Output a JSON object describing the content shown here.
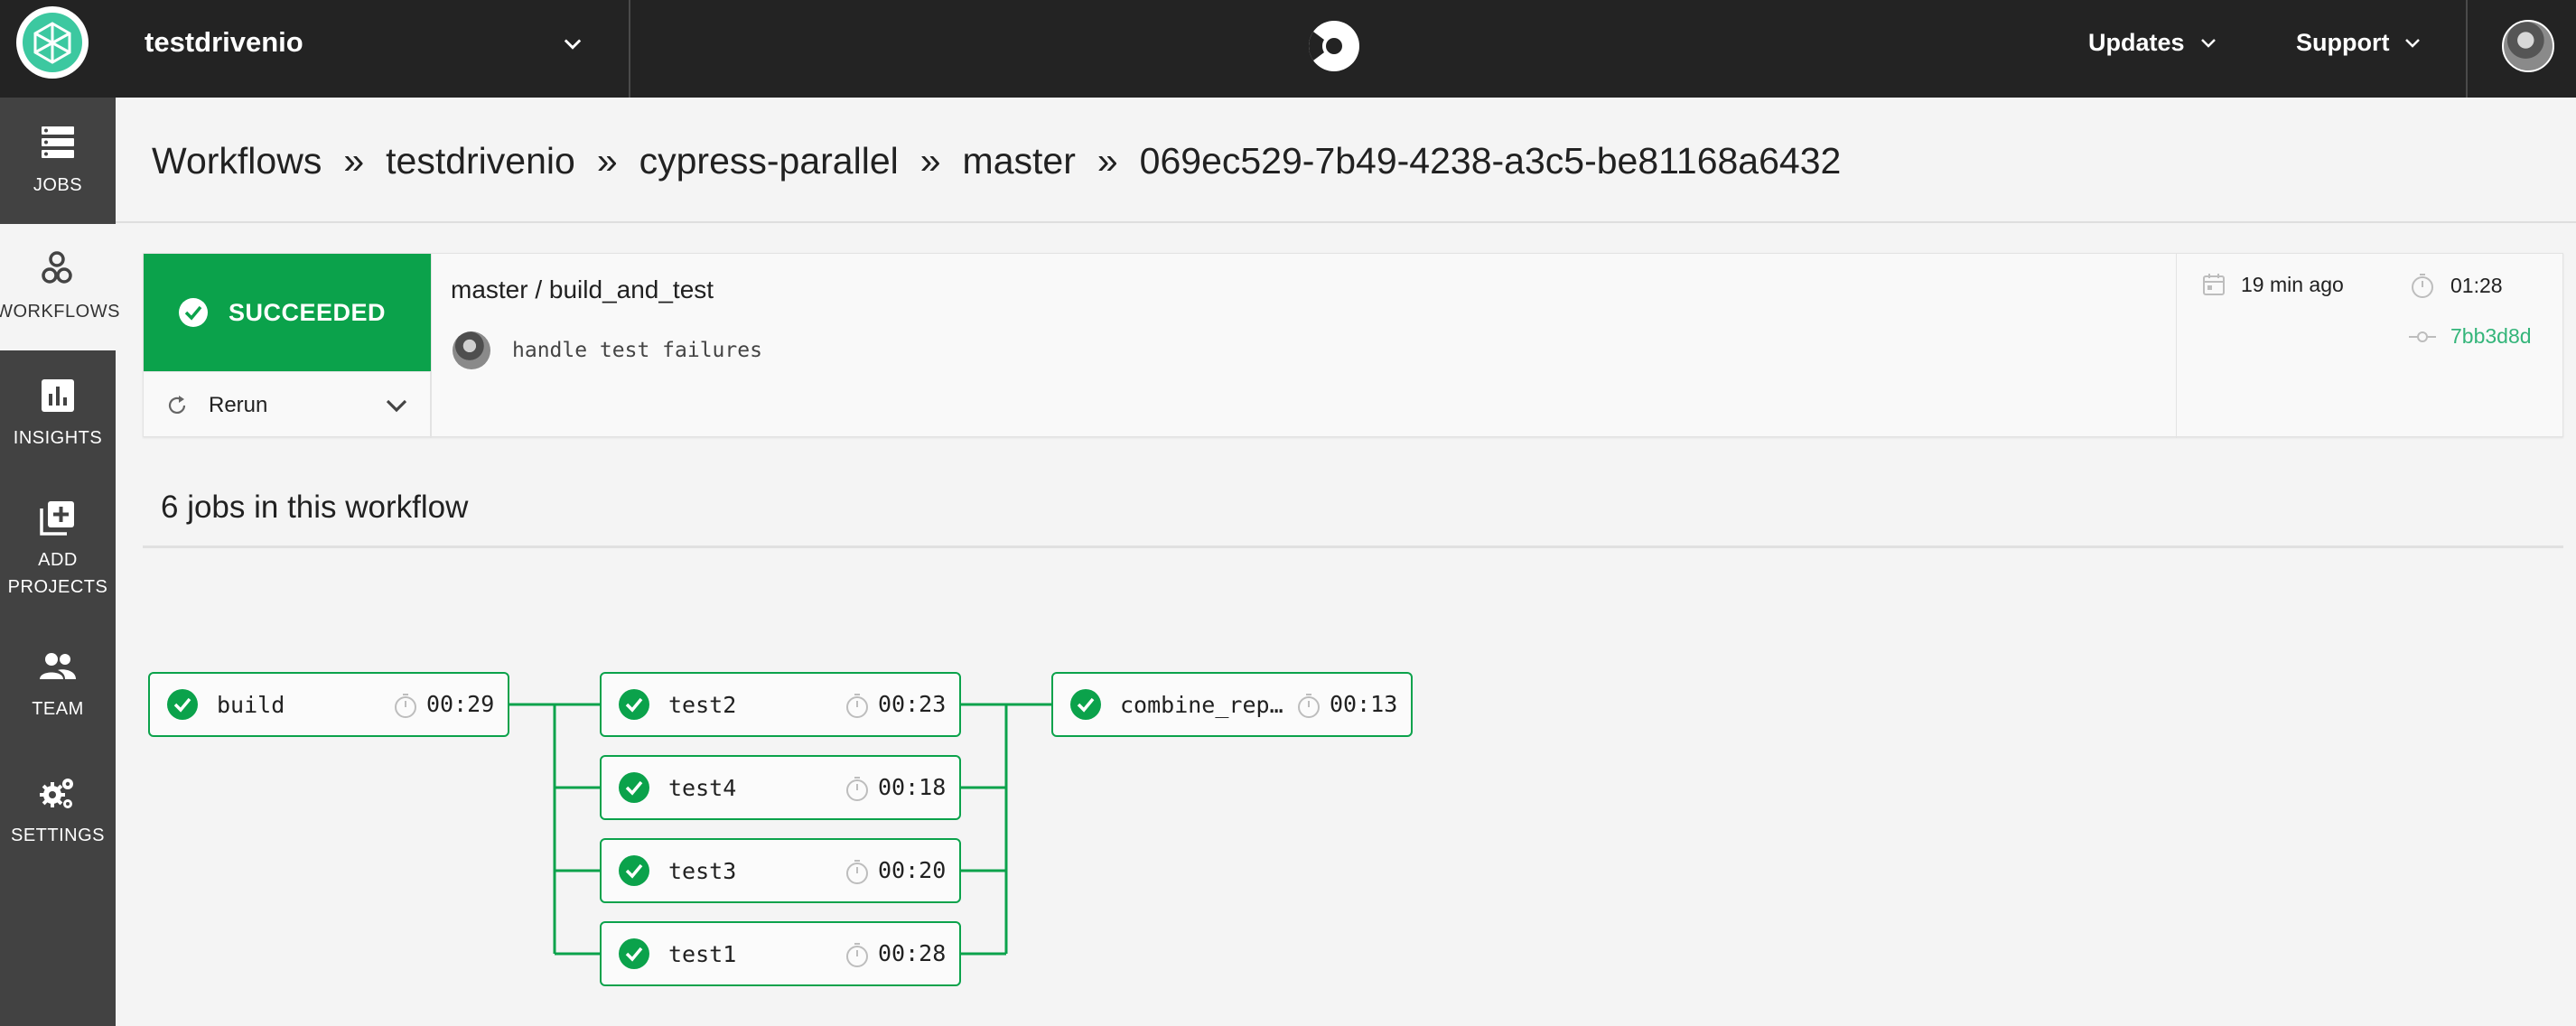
{
  "header": {
    "org_name": "testdrivenio",
    "nav": [
      {
        "label": "Updates"
      },
      {
        "label": "Support"
      }
    ]
  },
  "sidebar": {
    "items": [
      {
        "label": "JOBS",
        "icon": "jobs-icon"
      },
      {
        "label": "WORKFLOWS",
        "icon": "workflows-icon",
        "active": true
      },
      {
        "label": "INSIGHTS",
        "icon": "insights-icon"
      },
      {
        "label": "ADD",
        "label2": "PROJECTS",
        "icon": "add-projects-icon"
      },
      {
        "label": "TEAM",
        "icon": "team-icon"
      },
      {
        "label": "SETTINGS",
        "icon": "settings-icon"
      }
    ]
  },
  "breadcrumb": [
    "Workflows",
    "testdrivenio",
    "cypress-parallel",
    "master",
    "069ec529-7b49-4238-a3c5-be81168a6432"
  ],
  "breadcrumb_sep": "»",
  "summary": {
    "status": "SUCCEEDED",
    "rerun_label": "Rerun",
    "workflow_title": "master / build_and_test",
    "commit_message": "handle test failures",
    "time_ago": "19 min ago",
    "duration": "01:28",
    "commit_sha": "7bb3d8d"
  },
  "jobs_heading": "6 jobs in this workflow",
  "jobs": [
    {
      "name": "build",
      "duration": "00:29"
    },
    {
      "name": "test2",
      "duration": "00:23"
    },
    {
      "name": "test4",
      "duration": "00:18"
    },
    {
      "name": "test3",
      "duration": "00:20"
    },
    {
      "name": "test1",
      "duration": "00:28"
    },
    {
      "name": "combine_repo…",
      "duration": "00:13"
    }
  ],
  "colors": {
    "success": "#0ba24b",
    "topbar": "#232323",
    "sidebar": "#424242",
    "link": "#34b57a"
  }
}
